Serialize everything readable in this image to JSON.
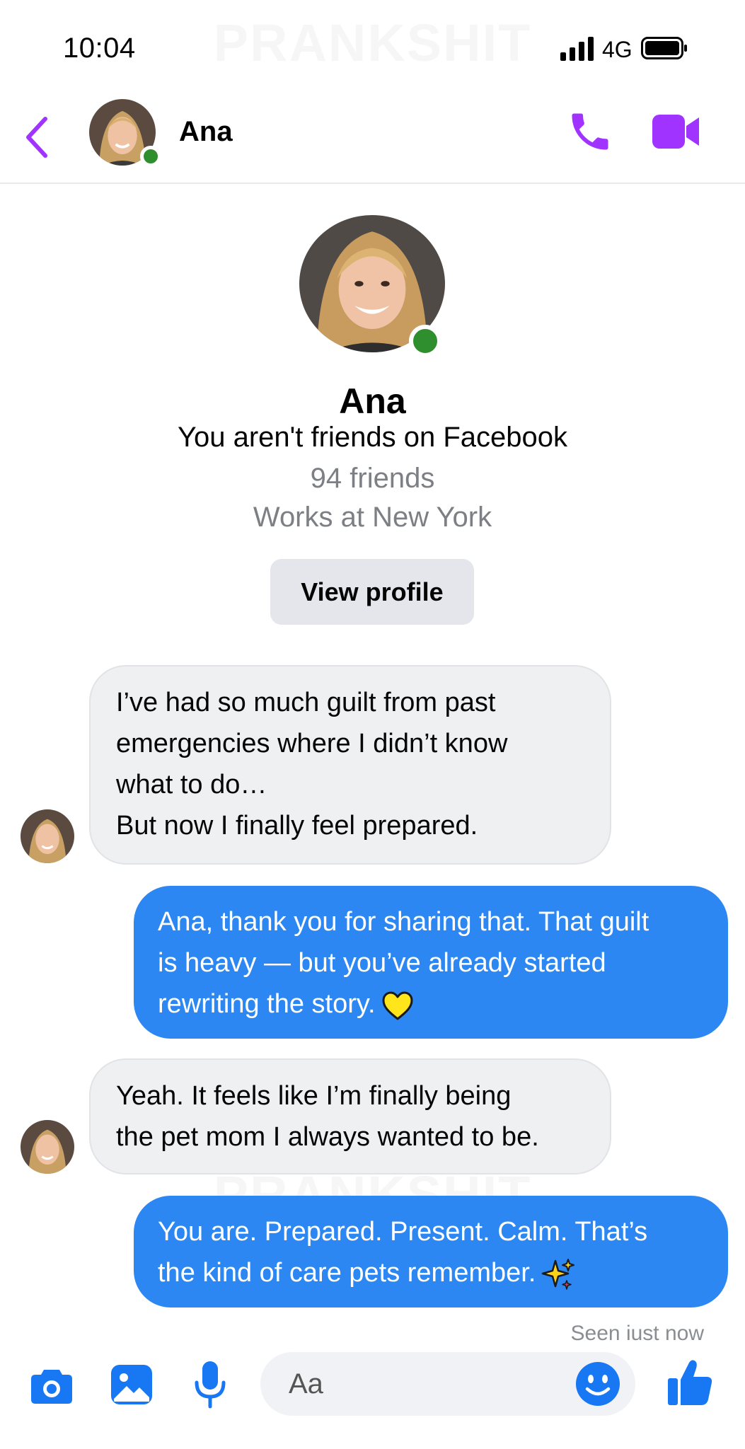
{
  "status_bar": {
    "time": "10:04",
    "network": "4G"
  },
  "watermark": "PRANKSHIT",
  "header": {
    "contact_name": "Ana"
  },
  "profile": {
    "name": "Ana",
    "relationship": "You aren't friends on Facebook",
    "friends": "94 friends",
    "work": "Works at New York",
    "button_label": "View profile"
  },
  "messages": [
    {
      "direction": "incoming",
      "text": "I’ve had so much guilt from past\nemergencies where I didn’t know\nwhat to do…\nBut now I finally feel prepared."
    },
    {
      "direction": "outgoing",
      "text": "Ana, thank you for sharing that. That guilt\nis heavy — but you’ve already started\nrewriting the story.",
      "emoji": "yellow-heart"
    },
    {
      "direction": "incoming",
      "text": "Yeah. It feels like I’m finally being\nthe pet mom I always wanted to be."
    },
    {
      "direction": "outgoing",
      "text": "You are. Prepared. Present. Calm. That’s\nthe kind of care pets remember.",
      "emoji": "sparkles"
    }
  ],
  "seen_status": "Seen iust now",
  "composer": {
    "placeholder": "Aa"
  },
  "colors": {
    "accent_purple": "#a033ff",
    "messenger_blue": "#2d87f2",
    "online_green": "#2f8f2f",
    "incoming_bubble": "#eff0f2"
  },
  "icons": [
    "back-icon",
    "phone-icon",
    "video-call-icon",
    "camera-icon",
    "gallery-icon",
    "microphone-icon",
    "emoji-icon",
    "thumbs-up-icon"
  ]
}
